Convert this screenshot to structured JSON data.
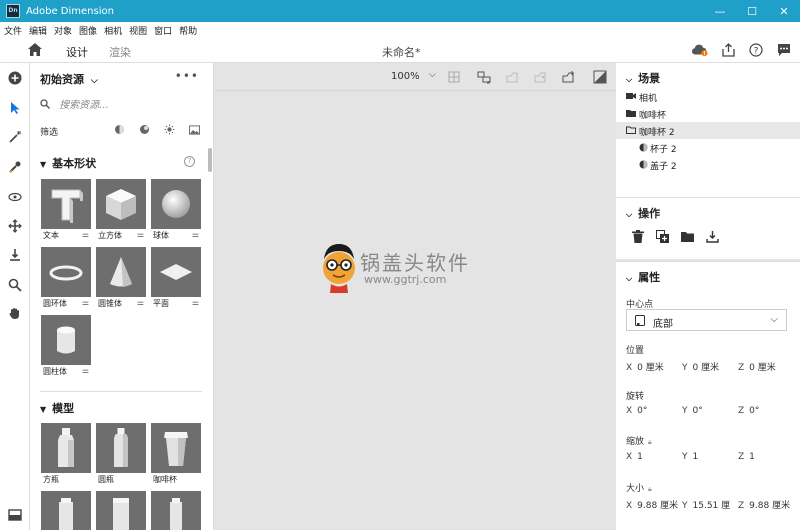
{
  "window": {
    "title": "Adobe Dimension",
    "app_icon_text": "Dn"
  },
  "menu": [
    "文件",
    "编辑",
    "对象",
    "图像",
    "相机",
    "视图",
    "窗口",
    "帮助"
  ],
  "tabs": {
    "design": "设计",
    "render": "渲染"
  },
  "document_title": "未命名*",
  "assets": {
    "header": "初始资源",
    "search_placeholder": "搜索资源...",
    "filter_label": "筛选",
    "basic_shapes": {
      "title": "基本形状",
      "items": [
        "文本",
        "立方体",
        "球体",
        "圆环体",
        "圆锥体",
        "平面",
        "圆柱体"
      ]
    },
    "models": {
      "title": "模型",
      "items": [
        "方瓶",
        "圆瓶",
        "咖啡杯"
      ]
    }
  },
  "canvas": {
    "zoom": "100%"
  },
  "watermark": {
    "text": "锅盖头软件",
    "url": "www.ggtrj.com"
  },
  "scene": {
    "title": "场景",
    "items": [
      {
        "label": "相机",
        "icon": "camera-icon"
      },
      {
        "label": "咖啡杯",
        "icon": "folder-icon"
      },
      {
        "label": "咖啡杯 2",
        "icon": "folder-open-icon",
        "selected": true
      },
      {
        "label": "杯子 2",
        "icon": "material-icon"
      },
      {
        "label": "盖子 2",
        "icon": "material-icon"
      }
    ]
  },
  "actions": {
    "title": "操作"
  },
  "properties": {
    "title": "属性",
    "pivot_label": "中心点",
    "pivot_value": "底部",
    "position": {
      "label": "位置",
      "x": "0 厘米",
      "y": "0 厘米",
      "z": "0 厘米"
    },
    "rotation": {
      "label": "旋转",
      "x": "0°",
      "y": "0°",
      "z": "0°"
    },
    "scale": {
      "label": "缩放",
      "x": "1",
      "y": "1",
      "z": "1"
    },
    "size": {
      "label": "大小",
      "x": "9.88 厘米",
      "y": "15.51 厘",
      "z": "9.88 厘米"
    },
    "axes": {
      "x": "X",
      "y": "Y",
      "z": "Z"
    }
  },
  "colors": {
    "titlebar": "#1ea0c8",
    "accent": "#1473e6"
  }
}
